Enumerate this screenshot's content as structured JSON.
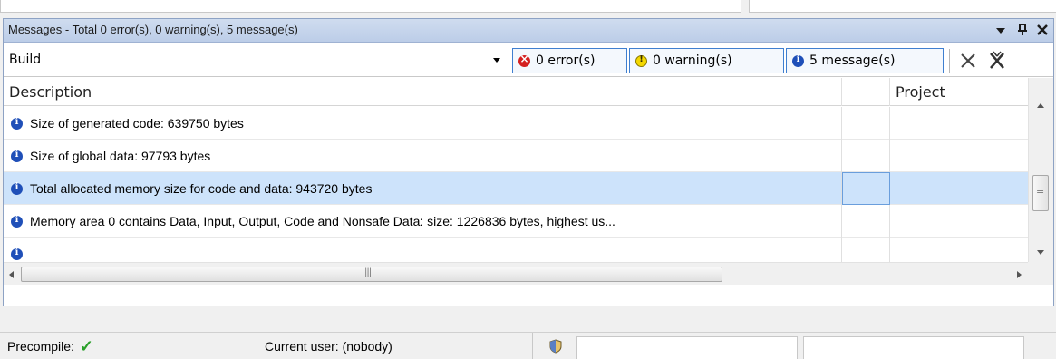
{
  "panel": {
    "title": "Messages - Total 0 error(s), 0 warning(s), 5 message(s)",
    "controls": {
      "dropdown": "▾",
      "pin": "ᵖ",
      "close": "✕"
    }
  },
  "toolbar": {
    "category_value": "Build",
    "filters": {
      "errors": "0 error(s)",
      "warnings": "0 warning(s)",
      "messages": "5 message(s)"
    },
    "icons": {
      "error": "error-icon",
      "warning": "warning-icon",
      "info": "info-icon",
      "clear": "clear-icon",
      "clear_all": "clear-all-icon"
    }
  },
  "grid": {
    "columns": [
      "Description",
      "",
      "Project"
    ],
    "rows": [
      {
        "description": "Size of generated code: 639750 bytes",
        "selected": false
      },
      {
        "description": "Size of global data: 97793 bytes",
        "selected": false
      },
      {
        "description": "Total allocated memory size for code and data: 943720 bytes",
        "selected": true
      },
      {
        "description": "Memory area 0 contains  Data, Input, Output, Code and Nonsafe Data: size: 1226836 bytes, highest us...",
        "selected": false
      }
    ]
  },
  "statusbar": {
    "precompile_label": "Precompile:",
    "precompile_ok": "✓",
    "current_user": "Current user: (nobody)"
  }
}
